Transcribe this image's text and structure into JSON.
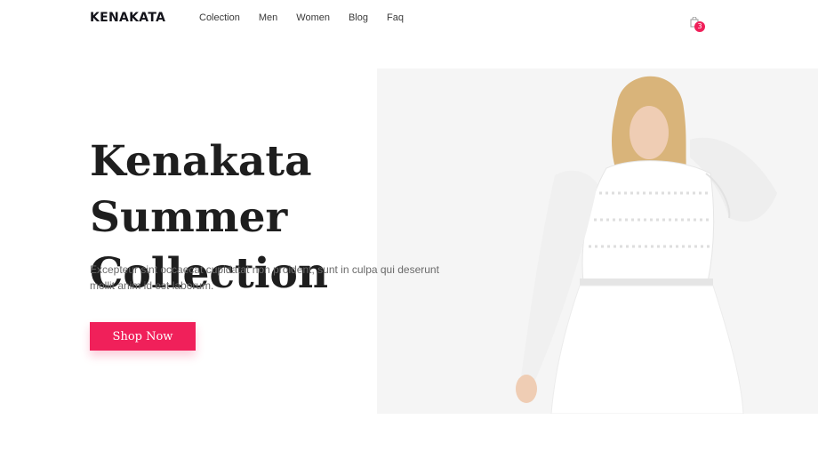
{
  "header": {
    "logo": "KENAKATA",
    "nav": [
      "Colection",
      "Men",
      "Women",
      "Blog",
      "Faq"
    ],
    "cart_count": "3"
  },
  "hero": {
    "title_line1": "Kenakata Summer",
    "title_line2": "Collection",
    "description": "Excepteur sint occaecat cupidatat non proident, sunt in culpa qui deserunt mollit anim id est laborum.",
    "cta_label": "Shop Now"
  },
  "colors": {
    "accent": "#f0205a",
    "text_dark": "#1e1e1e",
    "hero_bg": "#f5f5f5"
  },
  "icons": [
    "shopping-bag-icon"
  ]
}
